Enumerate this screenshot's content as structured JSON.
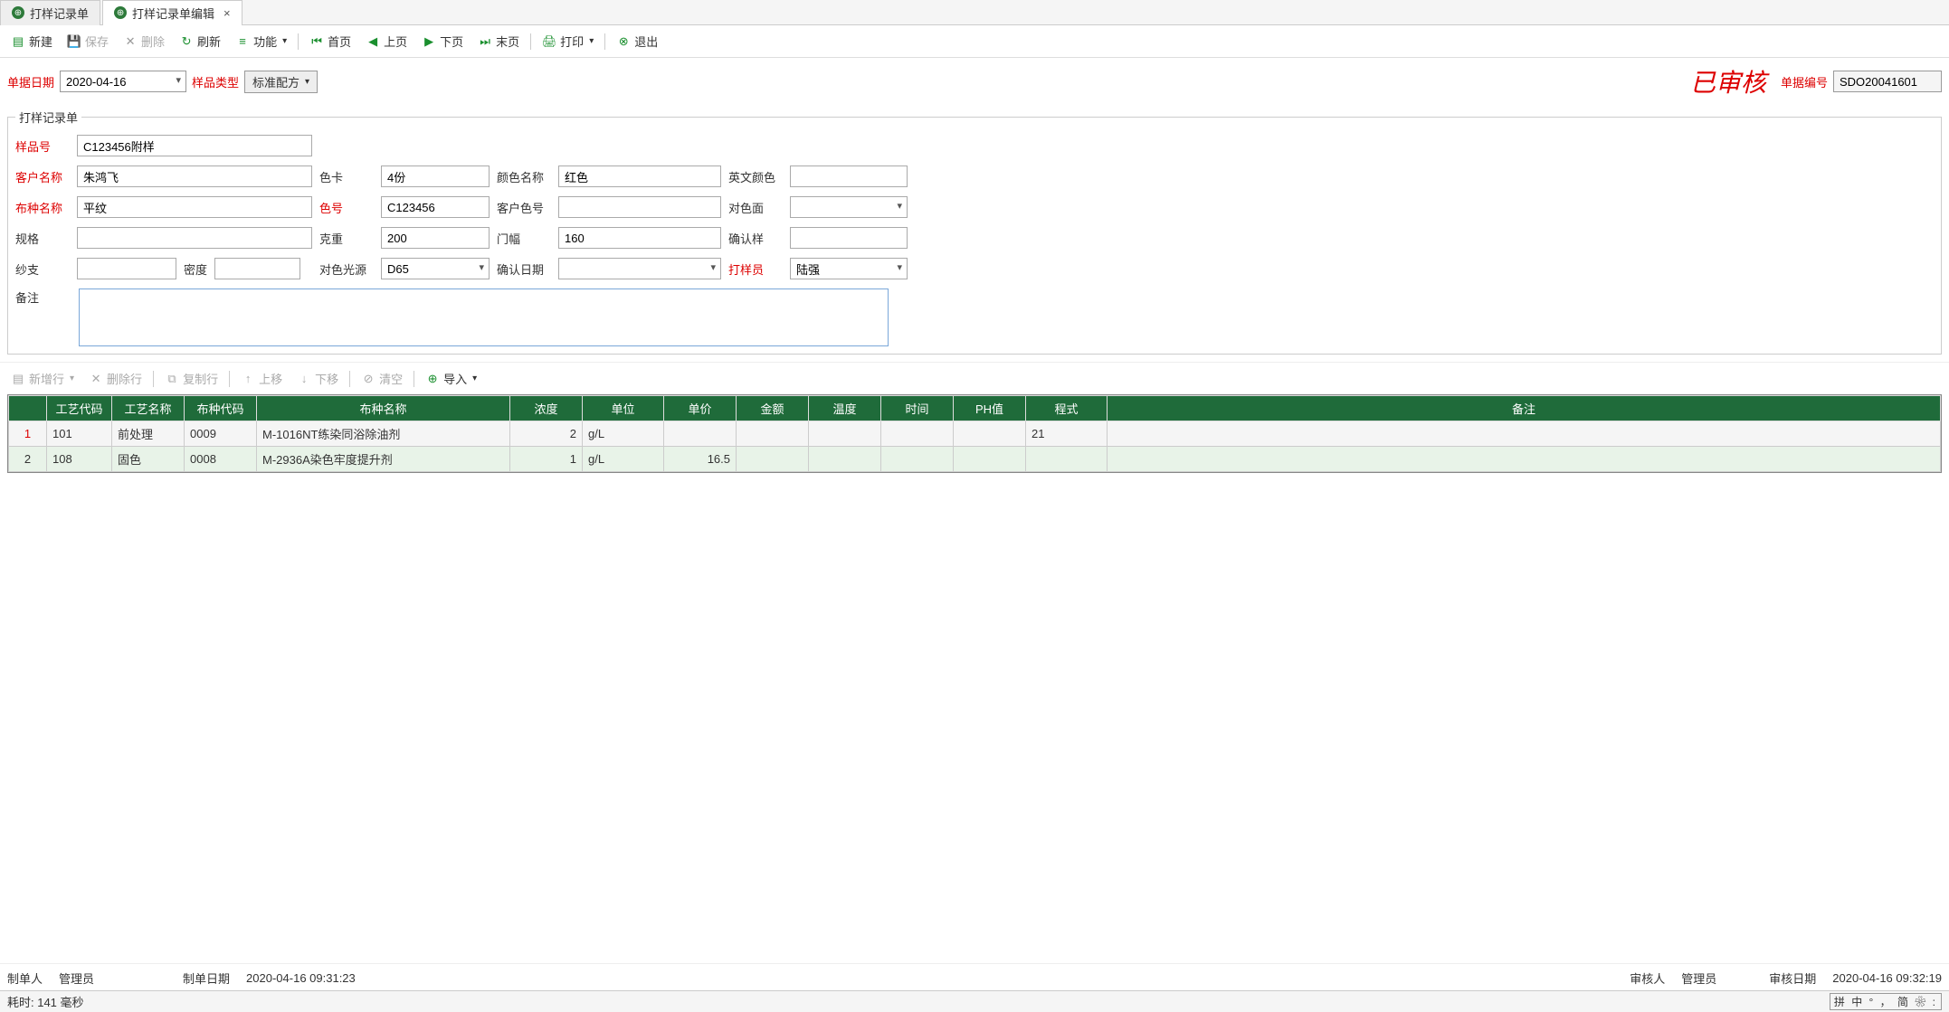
{
  "tabs": [
    {
      "label": "打样记录单",
      "active": false
    },
    {
      "label": "打样记录单编辑",
      "active": true
    }
  ],
  "toolbar": {
    "new": "新建",
    "save": "保存",
    "delete": "删除",
    "refresh": "刷新",
    "func": "功能",
    "first": "首页",
    "prev": "上页",
    "next": "下页",
    "last": "末页",
    "print": "打印",
    "exit": "退出"
  },
  "meta": {
    "date_label": "单据日期",
    "date": "2020-04-16",
    "sample_type_label": "样品类型",
    "formula_type": "标准配方",
    "approved": "已审核",
    "docno_label": "单据编号",
    "docno": "SDO20041601"
  },
  "fieldset_legend": "打样记录单",
  "form": {
    "sample_no_label": "样品号",
    "sample_no": "C123456附样",
    "customer_label": "客户名称",
    "customer": "朱鸿飞",
    "color_card_label": "色卡",
    "color_card": "4份",
    "color_name_label": "颜色名称",
    "color_name": "红色",
    "en_color_label": "英文颜色",
    "en_color": "",
    "fabric_name_label": "布种名称",
    "fabric_name": "平纹",
    "color_no_label": "色号",
    "color_no": "C123456",
    "cust_color_no_label": "客户色号",
    "cust_color_no": "",
    "match_side_label": "对色面",
    "match_side": "",
    "spec_label": "规格",
    "spec": "",
    "weight_label": "克重",
    "weight": "200",
    "width_label": "门幅",
    "width": "160",
    "confirm_sample_label": "确认样",
    "confirm_sample": "",
    "yarn_label": "纱支",
    "yarn": "",
    "density_label": "密度",
    "density": "",
    "light_label": "对色光源",
    "light": "D65",
    "confirm_date_label": "确认日期",
    "confirm_date": "",
    "sampler_label": "打样员",
    "sampler": "陆强",
    "remark_label": "备注",
    "remark": ""
  },
  "sub_toolbar": {
    "addrow": "新增行",
    "delrow": "删除行",
    "copyrow": "复制行",
    "up": "上移",
    "down": "下移",
    "clear": "清空",
    "import": "导入"
  },
  "table": {
    "headers": [
      "",
      "工艺代码",
      "工艺名称",
      "布种代码",
      "布种名称",
      "浓度",
      "单位",
      "单价",
      "金额",
      "温度",
      "时间",
      "PH值",
      "程式",
      "备注"
    ],
    "rows": [
      {
        "rn": "1",
        "selected": true,
        "c1": "101",
        "c2": "前处理",
        "c3": "0009",
        "c4": "M-1016NT练染同浴除油剂",
        "c5": "2",
        "c6": "g/L",
        "c7": "",
        "c8": "",
        "c9": "",
        "c10": "",
        "c11": "",
        "c12": "21",
        "c13": ""
      },
      {
        "rn": "2",
        "selected": false,
        "c1": "108",
        "c2": "固色",
        "c3": "0008",
        "c4": "M-2936A染色牢度提升剂",
        "c5": "1",
        "c6": "g/L",
        "c7": "16.5",
        "c8": "",
        "c9": "",
        "c10": "",
        "c11": "",
        "c12": "",
        "c13": ""
      }
    ]
  },
  "footer": {
    "creator_label": "制单人",
    "creator": "管理员",
    "create_time_label": "制单日期",
    "create_time": "2020-04-16 09:31:23",
    "auditor_label": "审核人",
    "auditor": "管理员",
    "audit_time_label": "审核日期",
    "audit_time": "2020-04-16 09:32:19"
  },
  "status": {
    "elapsed": "耗时: 141 毫秒",
    "ime": "拼 中 ° ， 简 ❀ :"
  }
}
